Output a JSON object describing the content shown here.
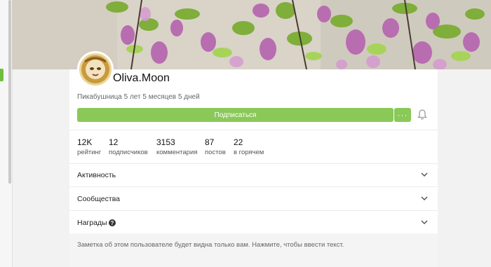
{
  "profile": {
    "username": "Oliva.Moon",
    "since": "Пикабушница 5 лет 5 месяцев 5 дней"
  },
  "actions": {
    "subscribe_label": "Подписаться",
    "more_label": "···"
  },
  "stats": [
    {
      "value": "12K",
      "label": "рейтинг"
    },
    {
      "value": "12",
      "label": "подписчиков"
    },
    {
      "value": "3153",
      "label": "комментария"
    },
    {
      "value": "87",
      "label": "постов"
    },
    {
      "value": "22",
      "label": "в горячем"
    }
  ],
  "sections": [
    {
      "title": "Активность"
    },
    {
      "title": "Сообщества"
    },
    {
      "title": "Награды"
    }
  ],
  "note": {
    "text": "Заметка об этом пользователе будет видна только вам. Нажмите, чтобы ввести текст."
  },
  "colors": {
    "accent": "#8ac858",
    "panel": "#ffffff",
    "background": "#f2f2f2"
  }
}
